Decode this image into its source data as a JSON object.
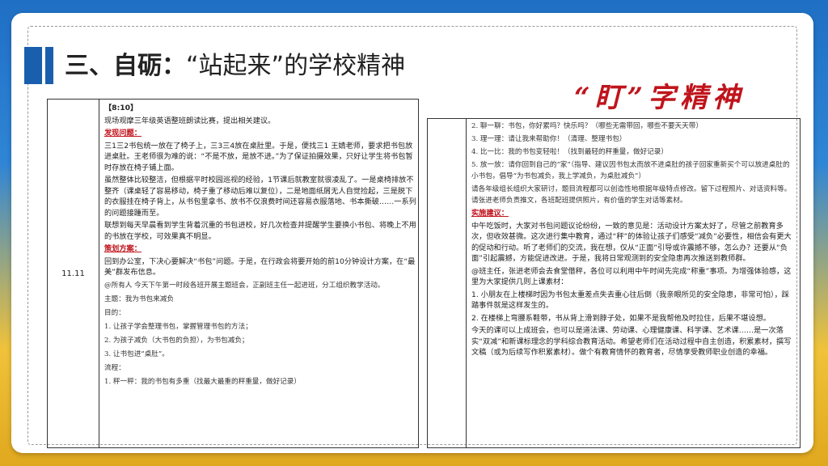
{
  "header": {
    "title": "三、自砺：",
    "title_quote": "“站起来”的学校精神",
    "stamp": "“盯”字精神"
  },
  "left": {
    "date": "11.11",
    "time": "【8:10】",
    "intro": "现场观摩三年级英语整班朗读比赛，提出相关建议。",
    "h_problem": "发现问题：",
    "p1": "三1三2书包统一放在了椅子上，三3三4放在桌肚里。于是，便找三1 王婧老师，要求把书包放进桌肚。王老师很为难的说：“不是不放，是放不进。”为了保证拍摄效果，只好让学生将书包暂时存放在椅子铺上面。",
    "p2": "虽然整体比较整洁，但根据平时校园巡视的经验，1节课后就教室就很凌乱了。一是桌椅排放不整齐（课桌轻了容易移动，椅子重了移动后难以复位），二是地面纸屑无人自觉捡起，三是脱下的衣服挂在椅子背上，从书包里拿书、放书不仅浪费时间还容易衣服落地、书本撕破……一系列的问题接踵而至。",
    "p3": "联想到每天早晨看到学生背着沉重的书包进校，好几次检查并提醒学生要换小书包、将晚上不用的书放在学校，可效果真不明显。",
    "h_plan": "策划方案：",
    "p4": "回到办公室，下决心要解决“书包”问题。于是，在行政会将要开始的前10分钟设计方案，在“最美”群发布信息。",
    "m1": "@所有人 今天下午第一时段各班开展主题班会，正副班主任一起进班，分工组织教学活动。",
    "m2": "主题：我为书包来减负",
    "m3": "目的：",
    "m4": "1. 让孩子学会整理书包，掌握管理书包的方法；",
    "m5": "2. 为孩子减负（大书包的负担），为书包减负；",
    "m6": "3. 让书包进“桌肚”。",
    "m7": "流程：",
    "m8": "1. 秤一秤：我的书包有多重（找最大最重的秤重量，做好记录）"
  },
  "right": {
    "r1": "2. 聊一聊：书包，你好累吗？快乐吗？（哪些无需带回，哪些不要天天带）",
    "r2": "3. 理一理：请让我来帮助你！（清理、整理书包）",
    "r3": "4. 比一比：我的书包变轻啦！（找到最轻的秤重量，做好记录）",
    "r4": "5. 放一放：请你回到自己的“家”（指导、建议因书包太而放不进桌肚的孩子回家重新买个可以放进桌肚的小书包，倡导“为书包减负，我上学减负，为桌肚减负”）",
    "r5": "请各年级组长组织大家研讨，题目流程都可以创造性地根据年级特点修改。留下过程照片、对话资料等。请张进老师负责推文，各班配班提供照片，有价值的学生对话等素材。",
    "h_impl": "实施建议：",
    "r6": "中午吃饭时，大家对书包问题议论纷纷，一致的意见是：活动设计方案太好了，尽管之前教育多次，但收效甚微。这次进行集中教育，通过“秤”的体验让孩子们感受“减负”必要性，相信会有更大的促动和行动。听了老师们的交流，我在想，仅从“正面”引导或许震撼不够，怎么办？还要从“负面”引起震撼，方能促进改进。于是，我将日常观测到的安全隐患再次推送到教师群。",
    "r7": "@班主任，张进老师会去食堂借秤，各位可以利用中午时间先完成“称重”事项。为增强体验感，这里为大家提供几则上课素材：",
    "r8": "1. 小朋友在上楼梯时因为书包太重差点失去重心往后倒（我亲眼所见的安全隐患，非常可怕），踩踏事件就是这样发生的。",
    "r9": "2. 在楼梯上弯腰系鞋带，书从背上滑到脖子处，如果不是我帮他及时拉住，后果不堪设想。",
    "r10": "今天的课可以上成班会，也可以是道法课、劳动课、心理健康课、科学课、艺术课……是一次落实“双减”和新课标理念的学科综合教育活动。希望老师们在活动过程中自主创造，积累素材，撰写文稿（或为后续写作积累素材）。做个有教育情怀的教育者，尽情享受教师职业创造的幸福。"
  }
}
